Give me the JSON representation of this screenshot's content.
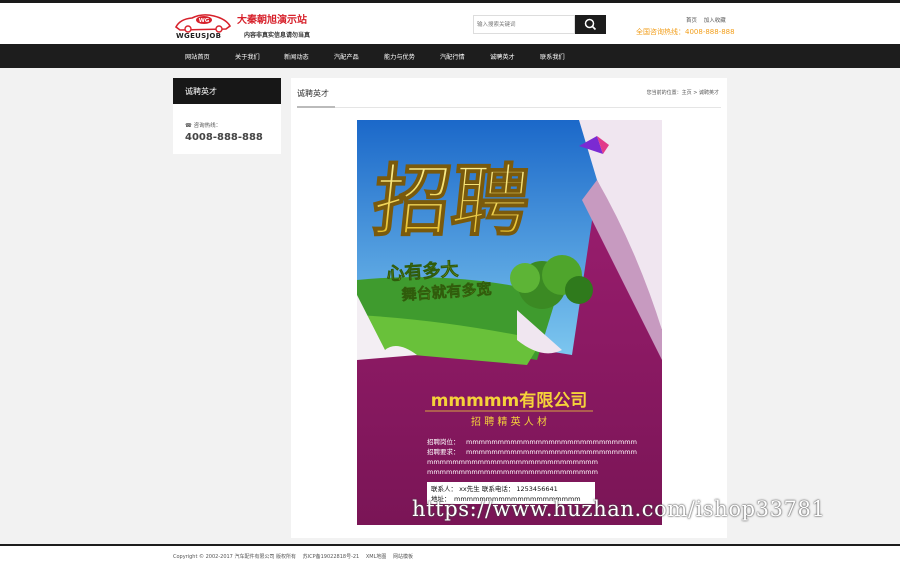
{
  "header": {
    "site_name": "大秦朝旭演示站",
    "slogan": "内容非真实信息请勿当真",
    "logo_badge": "WG",
    "logo_text": "WGEUSJOB",
    "search_placeholder": "输入搜索关键词",
    "top_links": [
      "首页",
      "加入收藏"
    ],
    "hotline": "全国咨询热线：4008-888-888"
  },
  "nav": {
    "items": [
      "网站首页",
      "关于我们",
      "新闻动态",
      "汽配产品",
      "能力与优势",
      "汽配行情",
      "诚聘英才",
      "联系我们"
    ]
  },
  "sidebar": {
    "title": "诚聘英才",
    "phone_label": "咨询热线：",
    "phone_number": "4008-888-888"
  },
  "main": {
    "title": "诚聘英才",
    "breadcrumb": "您当前的位置：主页 >  诚聘英才"
  },
  "poster": {
    "headline": "招聘",
    "slogan_1": "心有多大",
    "slogan_2": "舞台就有多宽",
    "company": "mmmmm有限公司",
    "subtitle": "招 聘 精 英 人 材",
    "job_label": "招聘岗位：",
    "req_label": "招聘要求：",
    "filler": "mmmmmmmmmmmmmmmmmmmmmmmmmmm",
    "contact": "联系人：  xx先生     联系电话：  1253456641",
    "address_label": "地址：",
    "address_filler": "mmmmmmmmmmmmmmmmmmmm"
  },
  "watermark": "https://www.huzhan.com/ishop33781",
  "footer": {
    "copyright": "Copyright © 2002-2017 汽车配件有限公司 版权所有",
    "icp": "苏ICP备19022818号-21",
    "links": [
      "XML地图",
      "网站模板"
    ]
  },
  "colors": {
    "brand_red": "#d7212b",
    "hotline_orange": "#f29e1a",
    "nav_bg": "#1d1d1d",
    "poster_magenta": "#8e1a63",
    "poster_gold": "#f5d23a"
  }
}
